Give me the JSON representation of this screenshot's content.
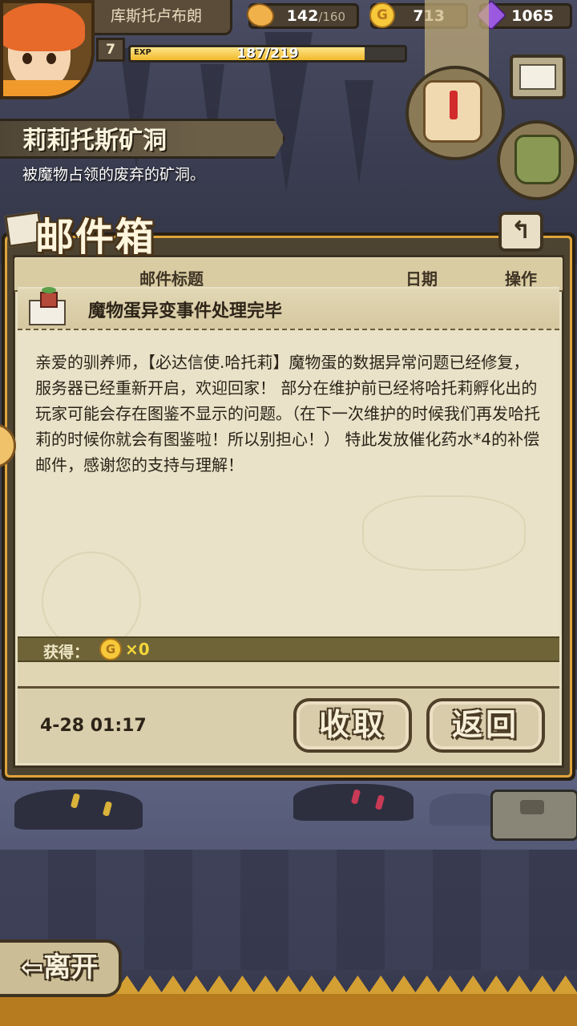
{
  "player": {
    "name": "库斯托卢布朗",
    "level": "7",
    "exp_label": "EXP",
    "exp_text": "187/219",
    "exp_fraction": 0.854
  },
  "resources": {
    "stamina": "142",
    "stamina_max": "/160",
    "gold": "713",
    "gems": "1065",
    "gold_symbol": "G"
  },
  "location": {
    "name": "莉莉托斯矿洞",
    "description": "被魔物占领的废弃的矿洞。"
  },
  "mailbox": {
    "title": "邮件箱",
    "back_symbol": "↰",
    "columns": {
      "subject": "邮件标题",
      "date": "日期",
      "action": "操作"
    }
  },
  "mail": {
    "subject": "魔物蛋异变事件处理完毕",
    "body": "亲爱的驯养师，【必达信使.哈托莉】魔物蛋的数据异常问题已经修复，服务器已经重新开启，欢迎回家！ 部分在维护前已经将哈托莉孵化出的玩家可能会存在图鉴不显示的问题。（在下一次维护的时候我们再发哈托莉的时候你就会有图鉴啦！所以别担心！） 特此发放催化药水*4的补偿邮件，感谢您的支持与理解！",
    "reward_label": "获得：",
    "reward_coin_symbol": "G",
    "reward_count": "×0",
    "date": "4-28 01:17",
    "collect_label": "收取",
    "return_label": "返回"
  },
  "footer": {
    "leave_label": "⇦离开"
  },
  "colors": {
    "panel_paper": "#e7dfc2",
    "panel_frame": "#4d4331",
    "accent_orange": "#e0a43a",
    "gold": "#f6c83a",
    "gem": "#9b59e0"
  }
}
